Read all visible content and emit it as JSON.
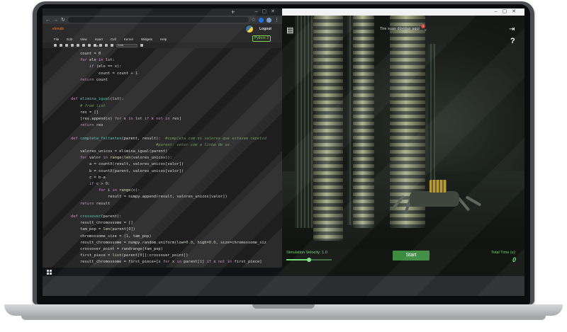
{
  "jupyter": {
    "logo_text": "elenabi",
    "logout_label": "Logout",
    "kernel_label": "Python 3",
    "menu": [
      "File",
      "Edit",
      "View",
      "Insert",
      "Cell",
      "Kernel",
      "Widgets",
      "Help"
    ],
    "toolbar": {
      "run_label": "Run",
      "cell_type": "Code"
    },
    "code_lines": [
      {
        "i": 1,
        "html": "count = 0"
      },
      {
        "i": 1,
        "html": "<span class='kw'>for</span> ele <span class='kw'>in</span> lst:"
      },
      {
        "i": 2,
        "html": "<span class='kw'>if</span> (ele == x):"
      },
      {
        "i": 3,
        "html": "count = count + <span class='nm'>1</span>"
      },
      {
        "i": 1,
        "html": "<span class='kw'>return</span> count"
      },
      {
        "i": 0,
        "html": ""
      },
      {
        "i": 0,
        "html": ""
      },
      {
        "i": 0,
        "html": "<span class='kw'>def</span> <span class='fn'>elimina_igual</span>(lst):"
      },
      {
        "i": 1,
        "html": "<span class='cm'># from list</span>"
      },
      {
        "i": 1,
        "html": "res = []"
      },
      {
        "i": 1,
        "html": "[res.append(x) <span class='kw'>for</span> x <span class='kw'>in</span> lst <span class='kw'>if</span> x <span class='kw'>not in</span> res]"
      },
      {
        "i": 1,
        "html": "<span class='kw'>return</span> res"
      },
      {
        "i": 0,
        "html": ""
      },
      {
        "i": 0,
        "html": "<span class='kw'>def</span> <span class='fn'>completa_faltantes</span>(parent, result):  <span class='cm'>#completa com os valores que estavam repetid</span>"
      },
      {
        "i": 0,
        "html": "                                     <span class='cm'>#parent: vetor com a linha de se</span>"
      },
      {
        "i": 1,
        "html": "valores_unicos = elimina_igual(parent)"
      },
      {
        "i": 1,
        "html": "<span class='kw'>for</span> valor <span class='kw'>in</span> <span class='bi'>range</span>(<span class='bi'>len</span>(valores_unicos)):"
      },
      {
        "i": 2,
        "html": "a = countX(result, valores_unicos[valor])"
      },
      {
        "i": 2,
        "html": "b = countX(parent, valores_unicos[valor])"
      },
      {
        "i": 2,
        "html": "c = b-a"
      },
      {
        "i": 2,
        "html": "<span class='kw'>if</span> c > <span class='nm'>0</span>:"
      },
      {
        "i": 3,
        "html": "<span class='kw'>for</span> i <span class='kw'>in</span> <span class='bi'>range</span>(c):"
      },
      {
        "i": 4,
        "html": "result = numpy.append(result, valores_unicos[valor])"
      },
      {
        "i": 1,
        "html": "<span class='kw'>return</span> result"
      },
      {
        "i": 0,
        "html": ""
      },
      {
        "i": 0,
        "html": "<span class='kw'>def</span> <span class='fn'>crossover</span>(parent):"
      },
      {
        "i": 1,
        "html": "result_chromossome = []"
      },
      {
        "i": 1,
        "html": "tam_pop = <span class='bi'>len</span>(parent[<span class='nm'>0</span>])"
      },
      {
        "i": 1,
        "html": "chromossome_size = (<span class='nm'>1</span>, tam_pop)"
      },
      {
        "i": 1,
        "html": "result_chromossome = numpy.random.uniform(low=<span class='nm'>0.0</span>, high=<span class='nm'>0.0</span>, size=chromossome_siz"
      },
      {
        "i": 1,
        "html": "crossover_point = randrange(tam_pop)"
      },
      {
        "i": 1,
        "html": "first_piece = <span class='bi'>list</span>(parent[<span class='nm'>0</span>][:crossover_point])"
      },
      {
        "i": 1,
        "html": "result_chromossome = first_piece+[x <span class='kw'>for</span> x <span class='kw'>in</span> parent[<span class='nm'>1</span>] <span class='kw'>if</span> x <span class='kw'>not in</span> first_piece]"
      }
    ]
  },
  "simulation": {
    "help_message": "Tire suas dúvidas aqui",
    "notification_count": "1",
    "velocity_label": "Simulation Velocity: 1.0",
    "velocity_fraction": 0.5,
    "start_label": "Start",
    "total_time_label": "Total Time (s):",
    "total_time_value": "0",
    "help_button": "?",
    "accent_color": "#3d8b3f"
  }
}
